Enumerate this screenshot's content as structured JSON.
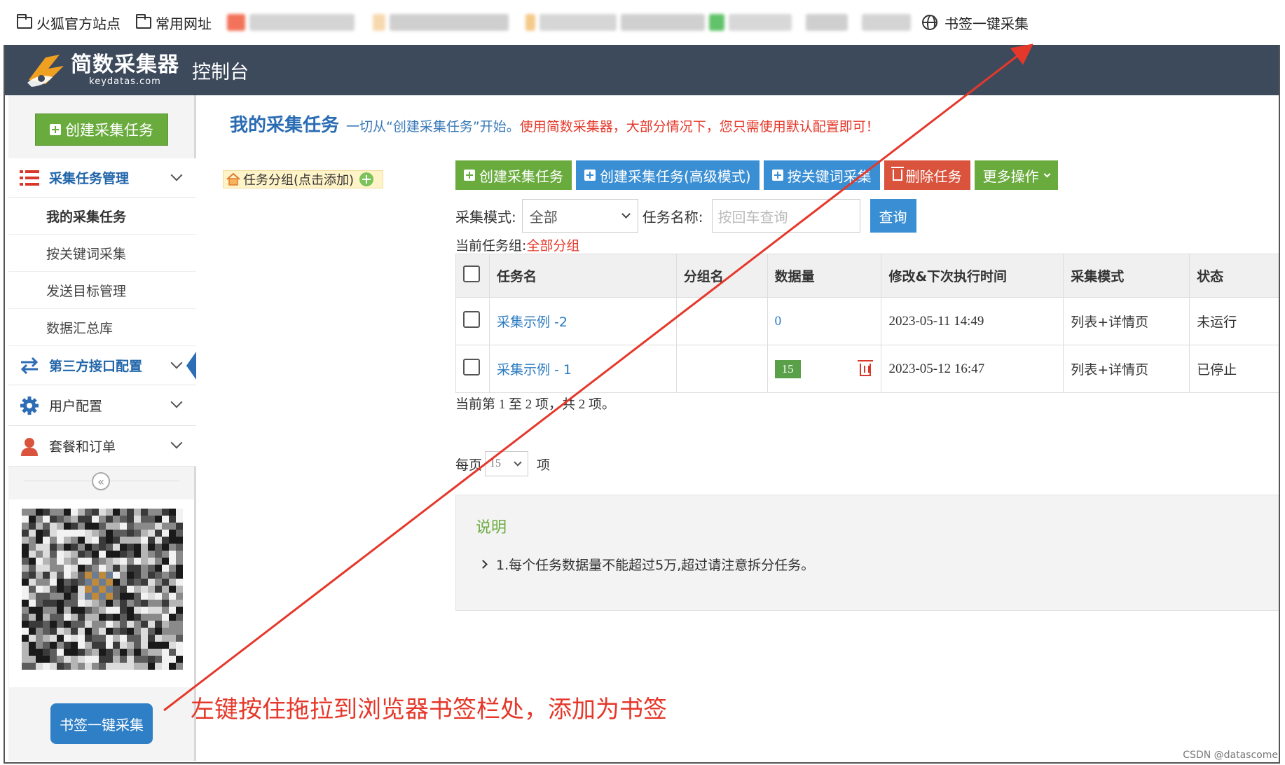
{
  "bookmarks_bar": {
    "items": [
      {
        "label": "火狐官方站点",
        "icon": "folder-icon"
      },
      {
        "label": "常用网址",
        "icon": "folder-icon"
      }
    ],
    "bookmarklet": {
      "label": "书签一键采集",
      "icon": "globe-icon"
    }
  },
  "header": {
    "logo_title": "简数采集器",
    "logo_subtitle": "keydatas.com",
    "console_title": "控制台"
  },
  "sidebar": {
    "create_button": "创建采集任务",
    "groups": [
      {
        "label": "采集任务管理",
        "icon": "list-icon",
        "subitems": [
          "我的采集任务",
          "按关键词采集",
          "发送目标管理",
          "数据汇总库"
        ]
      },
      {
        "label": "第三方接口配置",
        "icon": "exchange-icon"
      },
      {
        "label": "用户配置",
        "icon": "gear-icon"
      },
      {
        "label": "套餐和订单",
        "icon": "user-icon"
      }
    ],
    "bookmark_button": "书签一键采集"
  },
  "main": {
    "title": "我的采集任务",
    "desc_blue": "一切从“创建采集任务”开始。",
    "desc_red": "使用简数采集器，大部分情况下，您只需使用默认配置即可！",
    "group_tag": "任务分组(点击添加)",
    "toolbar": {
      "create": "创建采集任务",
      "create_advanced": "创建采集任务(高级模式)",
      "keyword": "按关键词采集",
      "delete": "删除任务",
      "more": "更多操作"
    },
    "filter": {
      "mode_label": "采集模式:",
      "mode_value": "全部",
      "name_label": "任务名称:",
      "name_placeholder": "按回车查询",
      "query_button": "查询"
    },
    "current_group_label": "当前任务组:",
    "current_group_value": "全部分组",
    "table": {
      "headers": [
        "任务名",
        "分组名",
        "数据量",
        "修改&下次执行时间",
        "采集模式",
        "状态"
      ],
      "rows": [
        {
          "name": "采集示例 -2",
          "group": "",
          "count": "0",
          "time": "2023-05-11 14:49",
          "mode": "列表+详情页",
          "status": "未运行"
        },
        {
          "name": "采集示例 - 1",
          "group": "",
          "count": "15",
          "time": "2023-05-12 16:47",
          "mode": "列表+详情页",
          "status": "已停止"
        }
      ]
    },
    "pager_info": "当前第 1 至 2 项，共 2 项。",
    "per_page_label": "每页",
    "per_page_value": "15",
    "per_page_unit": "项",
    "note": {
      "title": "说明",
      "items": [
        "1.每个任务数据量不能超过5万,超过请注意拆分任务。"
      ]
    }
  },
  "annotation": "左键按住拖拉到浏览器书签栏处，添加为书签",
  "watermark": "CSDN @datascome",
  "colors": {
    "header_bg": "#3d4a5c",
    "green": "#6aab3e",
    "blue": "#3a8fd4",
    "red": "#e5382a",
    "title_blue": "#2a6cb3"
  }
}
